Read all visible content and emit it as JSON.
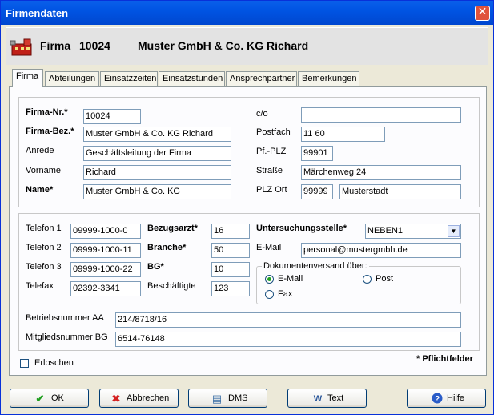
{
  "window": {
    "title": "Firmendaten",
    "close_glyph": "✕"
  },
  "header": {
    "label": "Firma",
    "id": "10024",
    "name": "Muster GmbH & Co. KG Richard",
    "icon": "company-icon"
  },
  "tabs": [
    "Firma",
    "Abteilungen",
    "Einsatzzeiten",
    "Einsatzstunden",
    "Ansprechpartner",
    "Bemerkungen"
  ],
  "firma": {
    "firma_nr": {
      "label": "Firma-Nr.*",
      "value": "10024"
    },
    "firma_bez": {
      "label": "Firma-Bez.*",
      "value": "Muster GmbH & Co. KG Richard"
    },
    "anrede": {
      "label": "Anrede",
      "value": "Geschäftsleitung der Firma"
    },
    "vorname": {
      "label": "Vorname",
      "value": "Richard"
    },
    "name": {
      "label": "Name*",
      "value": "Muster GmbH & Co. KG"
    },
    "co": {
      "label": "c/o",
      "value": ""
    },
    "postfach": {
      "label": "Postfach",
      "value": "11 60"
    },
    "pf_plz": {
      "label": "Pf.-PLZ",
      "value": "99901"
    },
    "strasse": {
      "label": "Straße",
      "value": "Märchenweg 24"
    },
    "plz_ort": {
      "label": "PLZ Ort",
      "plz": "99999",
      "ort": "Musterstadt"
    }
  },
  "kontakt": {
    "telefon1": {
      "label": "Telefon 1",
      "value": "09999-1000-0"
    },
    "telefon2": {
      "label": "Telefon 2",
      "value": "09999-1000-11"
    },
    "telefon3": {
      "label": "Telefon 3",
      "value": "09999-1000-22"
    },
    "telefax": {
      "label": "Telefax",
      "value": "02392-3341"
    },
    "bezugsarzt": {
      "label": "Bezugsarzt*",
      "value": "16"
    },
    "branche": {
      "label": "Branche*",
      "value": "50"
    },
    "bg": {
      "label": "BG*",
      "value": "10"
    },
    "beschaeftigte": {
      "label": "Beschäftigte",
      "value": "123"
    },
    "untersuchungsstelle": {
      "label": "Untersuchungsstelle*",
      "value": "NEBEN1"
    },
    "email": {
      "label": "E-Mail",
      "value": "personal@mustergmbh.de"
    },
    "versand": {
      "legend": "Dokumentenversand über:",
      "options": [
        "E-Mail",
        "Post",
        "Fax"
      ],
      "selected": "E-Mail"
    },
    "betriebsnummer": {
      "label": "Betriebsnummer AA",
      "value": "214/8718/16"
    },
    "mitgliedsnummer": {
      "label": "Mitgliedsnummer BG",
      "value": "6514-76148"
    }
  },
  "erloschen": {
    "label": "Erloschen",
    "checked": false
  },
  "pflichtfelder": "* Pflichtfelder",
  "buttons": {
    "ok": "OK",
    "abbrechen": "Abbrechen",
    "dms": "DMS",
    "text": "Text",
    "hilfe": "Hilfe"
  },
  "colors": {
    "titlebar": "#0054E3",
    "ok_icon": "#1E9E1E",
    "cancel_icon": "#D42020",
    "help_icon": "#2A5CC8"
  }
}
